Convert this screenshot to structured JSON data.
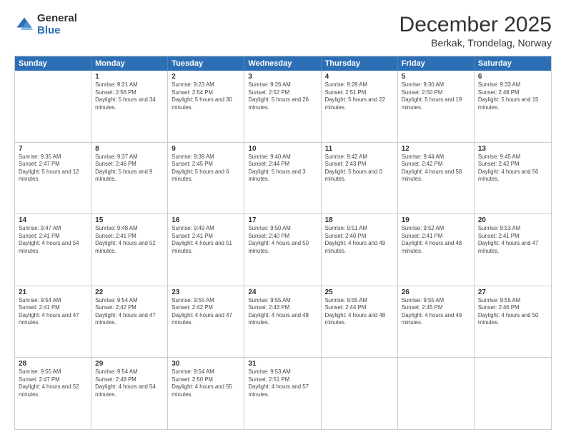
{
  "logo": {
    "general": "General",
    "blue": "Blue"
  },
  "title": {
    "month": "December 2025",
    "location": "Berkak, Trondelag, Norway"
  },
  "header_days": [
    "Sunday",
    "Monday",
    "Tuesday",
    "Wednesday",
    "Thursday",
    "Friday",
    "Saturday"
  ],
  "weeks": [
    [
      {
        "day": "",
        "empty": true
      },
      {
        "day": "1",
        "sunrise": "Sunrise: 9:21 AM",
        "sunset": "Sunset: 2:56 PM",
        "daylight": "Daylight: 5 hours and 34 minutes."
      },
      {
        "day": "2",
        "sunrise": "Sunrise: 9:23 AM",
        "sunset": "Sunset: 2:54 PM",
        "daylight": "Daylight: 5 hours and 30 minutes."
      },
      {
        "day": "3",
        "sunrise": "Sunrise: 9:26 AM",
        "sunset": "Sunset: 2:52 PM",
        "daylight": "Daylight: 5 hours and 26 minutes."
      },
      {
        "day": "4",
        "sunrise": "Sunrise: 9:28 AM",
        "sunset": "Sunset: 2:51 PM",
        "daylight": "Daylight: 5 hours and 22 minutes."
      },
      {
        "day": "5",
        "sunrise": "Sunrise: 9:30 AM",
        "sunset": "Sunset: 2:50 PM",
        "daylight": "Daylight: 5 hours and 19 minutes."
      },
      {
        "day": "6",
        "sunrise": "Sunrise: 9:33 AM",
        "sunset": "Sunset: 2:48 PM",
        "daylight": "Daylight: 5 hours and 15 minutes."
      }
    ],
    [
      {
        "day": "7",
        "sunrise": "Sunrise: 9:35 AM",
        "sunset": "Sunset: 2:47 PM",
        "daylight": "Daylight: 5 hours and 12 minutes."
      },
      {
        "day": "8",
        "sunrise": "Sunrise: 9:37 AM",
        "sunset": "Sunset: 2:46 PM",
        "daylight": "Daylight: 5 hours and 9 minutes."
      },
      {
        "day": "9",
        "sunrise": "Sunrise: 9:39 AM",
        "sunset": "Sunset: 2:45 PM",
        "daylight": "Daylight: 5 hours and 6 minutes."
      },
      {
        "day": "10",
        "sunrise": "Sunrise: 9:40 AM",
        "sunset": "Sunset: 2:44 PM",
        "daylight": "Daylight: 5 hours and 3 minutes."
      },
      {
        "day": "11",
        "sunrise": "Sunrise: 9:42 AM",
        "sunset": "Sunset: 2:43 PM",
        "daylight": "Daylight: 5 hours and 0 minutes."
      },
      {
        "day": "12",
        "sunrise": "Sunrise: 9:44 AM",
        "sunset": "Sunset: 2:42 PM",
        "daylight": "Daylight: 4 hours and 58 minutes."
      },
      {
        "day": "13",
        "sunrise": "Sunrise: 9:45 AM",
        "sunset": "Sunset: 2:42 PM",
        "daylight": "Daylight: 4 hours and 56 minutes."
      }
    ],
    [
      {
        "day": "14",
        "sunrise": "Sunrise: 9:47 AM",
        "sunset": "Sunset: 2:41 PM",
        "daylight": "Daylight: 4 hours and 54 minutes."
      },
      {
        "day": "15",
        "sunrise": "Sunrise: 9:48 AM",
        "sunset": "Sunset: 2:41 PM",
        "daylight": "Daylight: 4 hours and 52 minutes."
      },
      {
        "day": "16",
        "sunrise": "Sunrise: 9:49 AM",
        "sunset": "Sunset: 2:41 PM",
        "daylight": "Daylight: 4 hours and 51 minutes."
      },
      {
        "day": "17",
        "sunrise": "Sunrise: 9:50 AM",
        "sunset": "Sunset: 2:40 PM",
        "daylight": "Daylight: 4 hours and 50 minutes."
      },
      {
        "day": "18",
        "sunrise": "Sunrise: 9:51 AM",
        "sunset": "Sunset: 2:40 PM",
        "daylight": "Daylight: 4 hours and 49 minutes."
      },
      {
        "day": "19",
        "sunrise": "Sunrise: 9:52 AM",
        "sunset": "Sunset: 2:41 PM",
        "daylight": "Daylight: 4 hours and 48 minutes."
      },
      {
        "day": "20",
        "sunrise": "Sunrise: 9:53 AM",
        "sunset": "Sunset: 2:41 PM",
        "daylight": "Daylight: 4 hours and 47 minutes."
      }
    ],
    [
      {
        "day": "21",
        "sunrise": "Sunrise: 9:54 AM",
        "sunset": "Sunset: 2:41 PM",
        "daylight": "Daylight: 4 hours and 47 minutes."
      },
      {
        "day": "22",
        "sunrise": "Sunrise: 9:54 AM",
        "sunset": "Sunset: 2:42 PM",
        "daylight": "Daylight: 4 hours and 47 minutes."
      },
      {
        "day": "23",
        "sunrise": "Sunrise: 9:55 AM",
        "sunset": "Sunset: 2:42 PM",
        "daylight": "Daylight: 4 hours and 47 minutes."
      },
      {
        "day": "24",
        "sunrise": "Sunrise: 9:55 AM",
        "sunset": "Sunset: 2:43 PM",
        "daylight": "Daylight: 4 hours and 48 minutes."
      },
      {
        "day": "25",
        "sunrise": "Sunrise: 9:55 AM",
        "sunset": "Sunset: 2:44 PM",
        "daylight": "Daylight: 4 hours and 48 minutes."
      },
      {
        "day": "26",
        "sunrise": "Sunrise: 9:55 AM",
        "sunset": "Sunset: 2:45 PM",
        "daylight": "Daylight: 4 hours and 49 minutes."
      },
      {
        "day": "27",
        "sunrise": "Sunrise: 9:55 AM",
        "sunset": "Sunset: 2:46 PM",
        "daylight": "Daylight: 4 hours and 50 minutes."
      }
    ],
    [
      {
        "day": "28",
        "sunrise": "Sunrise: 9:55 AM",
        "sunset": "Sunset: 2:47 PM",
        "daylight": "Daylight: 4 hours and 52 minutes."
      },
      {
        "day": "29",
        "sunrise": "Sunrise: 9:54 AM",
        "sunset": "Sunset: 2:48 PM",
        "daylight": "Daylight: 4 hours and 54 minutes."
      },
      {
        "day": "30",
        "sunrise": "Sunrise: 9:54 AM",
        "sunset": "Sunset: 2:50 PM",
        "daylight": "Daylight: 4 hours and 55 minutes."
      },
      {
        "day": "31",
        "sunrise": "Sunrise: 9:53 AM",
        "sunset": "Sunset: 2:51 PM",
        "daylight": "Daylight: 4 hours and 57 minutes."
      },
      {
        "day": "",
        "empty": true
      },
      {
        "day": "",
        "empty": true
      },
      {
        "day": "",
        "empty": true
      }
    ]
  ]
}
